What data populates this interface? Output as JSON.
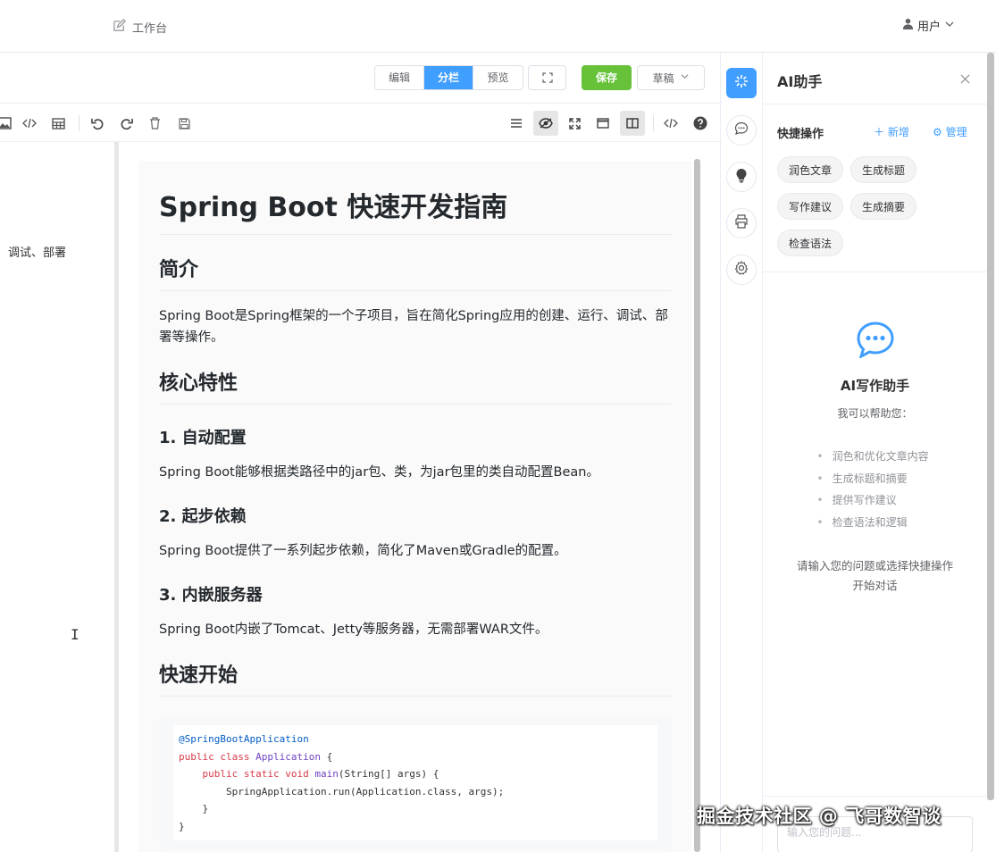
{
  "nav": {
    "workbench_label": "工作台",
    "user_label": "用户"
  },
  "editor": {
    "modes": [
      "编辑",
      "分栏",
      "预览"
    ],
    "active_mode": "分栏",
    "save_label": "保存",
    "status_label": "草稿",
    "left_fragment": "调试、部署"
  },
  "preview": {
    "title": "Spring Boot 快速开发指南",
    "intro_heading": "简介",
    "intro_text": "Spring Boot是Spring框架的一个子项目，旨在简化Spring应用的创建、运行、调试、部署等操作。",
    "features_heading": "核心特性",
    "features": [
      {
        "heading": "1. 自动配置",
        "text": "Spring Boot能够根据类路径中的jar包、类，为jar包里的类自动配置Bean。"
      },
      {
        "heading": "2. 起步依赖",
        "text": "Spring Boot提供了一系列起步依赖，简化了Maven或Gradle的配置。"
      },
      {
        "heading": "3. 内嵌服务器",
        "text": "Spring Boot内嵌了Tomcat、Jetty等服务器，无需部署WAR文件。"
      }
    ],
    "quickstart_heading": "快速开始",
    "code": {
      "line1": "@SpringBootApplication",
      "line2_kw": "public class",
      "line2_cls": "Application",
      "line2_rest": " {",
      "line3_kw": "    public static void",
      "line3_fn": "main",
      "line3_rest": "(String[] args) {",
      "line4": "        SpringApplication.run(Application.class, args);",
      "line5": "    }",
      "line6": "}"
    }
  },
  "ai": {
    "title": "AI助手",
    "quick_title": "快捷操作",
    "add_label": "新增",
    "manage_label": "管理",
    "chips": [
      "润色文章",
      "生成标题",
      "写作建议",
      "生成摘要",
      "检查语法"
    ],
    "welcome_title": "AI写作助手",
    "welcome_sub": "我可以帮助您：",
    "welcome_items": [
      "润色和优化文章内容",
      "生成标题和摘要",
      "提供写作建议",
      "检查语法和逻辑"
    ],
    "welcome_hint": "请输入您的问题或选择快捷操作开始对话",
    "input_placeholder": "输入您的问题..."
  },
  "watermark": "掘金技术社区 @ 飞哥数智谈",
  "colors": {
    "primary": "#409eff",
    "success": "#67c23a"
  }
}
